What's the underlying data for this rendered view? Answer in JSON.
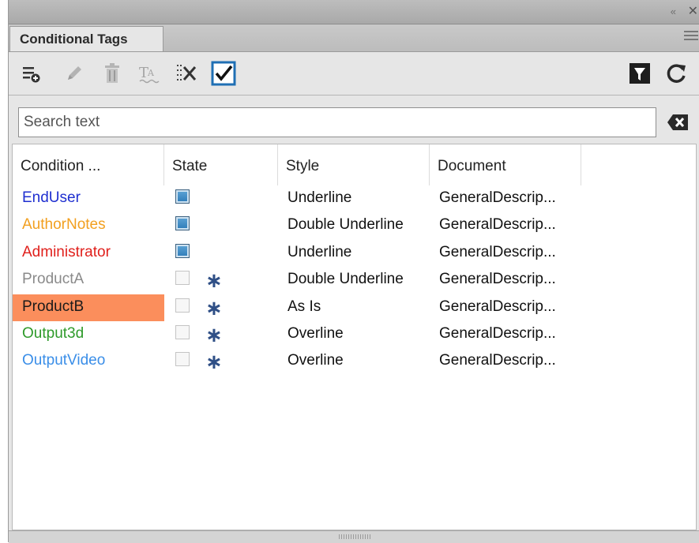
{
  "panel": {
    "tab_title": "Conditional Tags",
    "collapse_glyph": "«",
    "close_glyph": "✕"
  },
  "toolbar": {
    "buttons": [
      {
        "icon": "new-condition-icon",
        "enabled": true
      },
      {
        "icon": "edit-pencil-icon",
        "enabled": false
      },
      {
        "icon": "trash-icon",
        "enabled": false
      },
      {
        "icon": "text-format-icon",
        "enabled": false
      },
      {
        "icon": "remove-condition-icon",
        "enabled": true
      },
      {
        "icon": "checkbox-checked-icon",
        "enabled": true
      }
    ],
    "right_buttons": [
      {
        "icon": "filter-icon"
      },
      {
        "icon": "refresh-icon"
      }
    ]
  },
  "search": {
    "placeholder": "Search text",
    "value": ""
  },
  "columns": [
    "Condition ...",
    "State",
    "Style",
    "Document"
  ],
  "rows": [
    {
      "name": "EndUser",
      "color": "#1f2fd0",
      "state": "on",
      "star": "",
      "style": "Underline",
      "document": "GeneralDescrip...",
      "selected": false
    },
    {
      "name": "AuthorNotes",
      "color": "#f2a020",
      "state": "on",
      "star": "",
      "style": "Double Underline",
      "document": "GeneralDescrip...",
      "selected": false
    },
    {
      "name": "Administrator",
      "color": "#e0201c",
      "state": "on",
      "star": "",
      "style": "Underline",
      "document": "GeneralDescrip...",
      "selected": false
    },
    {
      "name": "ProductA",
      "color": "#8a8a8a",
      "state": "off",
      "star": "∗",
      "style": "Double Underline",
      "document": "GeneralDescrip...",
      "selected": false
    },
    {
      "name": "ProductB",
      "color": "#1a1a1a",
      "state": "off",
      "star": "∗",
      "style": "As Is",
      "document": "GeneralDescrip...",
      "selected": true
    },
    {
      "name": "Output3d",
      "color": "#2e9a2a",
      "state": "off",
      "star": "∗",
      "style": "Overline",
      "document": "GeneralDescrip...",
      "selected": false
    },
    {
      "name": "OutputVideo",
      "color": "#3a8ee8",
      "state": "off",
      "star": "∗",
      "style": "Overline",
      "document": "GeneralDescrip...",
      "selected": false
    }
  ],
  "colors": {
    "selection": "#fb8e5c",
    "checkbox_accent": "#1f6fb4"
  }
}
